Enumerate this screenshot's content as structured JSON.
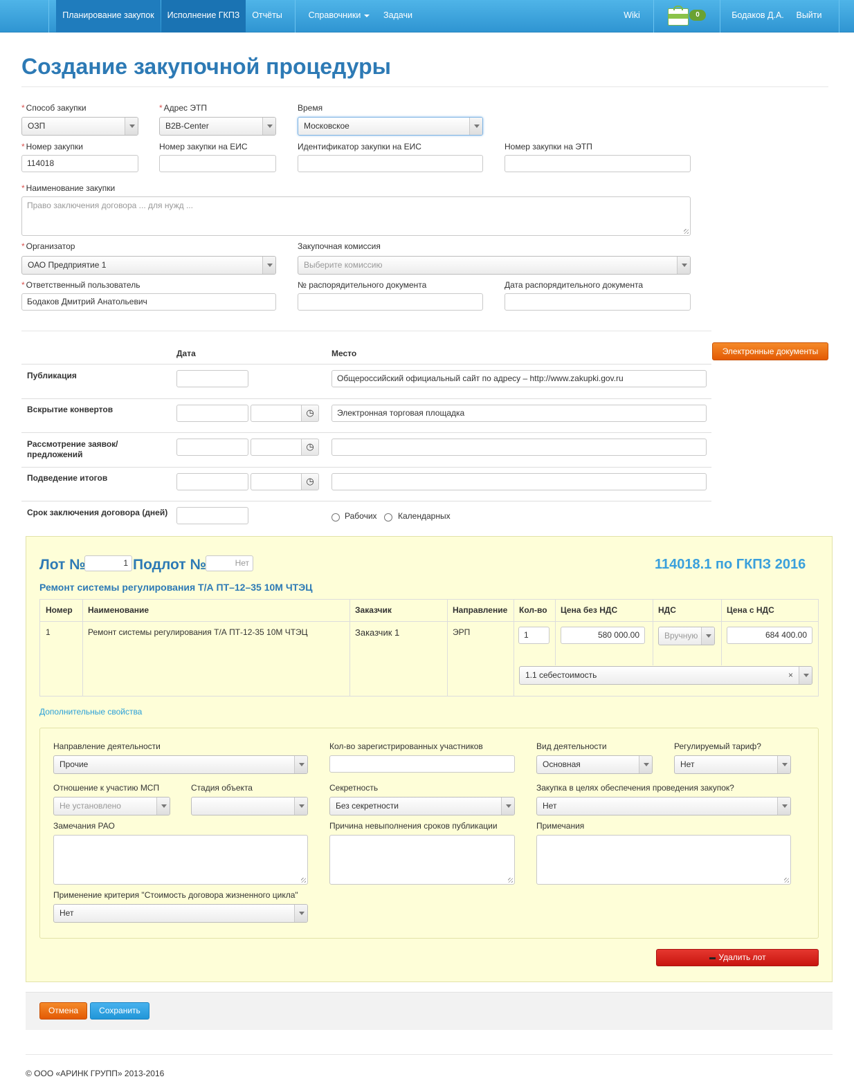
{
  "nav": {
    "items": [
      "Планирование закупок",
      "Исполнение ГКПЗ",
      "Отчёты",
      "Справочники",
      "Задачи"
    ],
    "wiki": "Wiki",
    "cart_count": "0",
    "user": "Бодаков Д.А.",
    "logout": "Выйти"
  },
  "page_title": "Создание закупочной процедуры",
  "form": {
    "method_label": "Способ закупки",
    "method_value": "ОЗП",
    "etp_label": "Адрес ЭТП",
    "etp_value": "B2B-Center",
    "time_label": "Время",
    "time_value": "Московское",
    "number_label": "Номер закупки",
    "number_value": "114018",
    "eis_number_label": "Номер закупки на ЕИС",
    "eis_id_label": "Идентификатор закупки на ЕИС",
    "etp_number_label": "Номер закупки на ЭТП",
    "name_label": "Наименование закупки",
    "name_placeholder": "Право заключения договора ... для нужд ...",
    "organizer_label": "Организатор",
    "organizer_value": "ОАО Предприятие 1",
    "commission_label": "Закупочная комиссия",
    "commission_placeholder": "Выберите комиссию",
    "responsible_label": "Ответственный пользователь",
    "responsible_value": "Бодаков Дмитрий Анатольевич",
    "order_doc_num_label": "№ распорядительного документа",
    "order_doc_date_label": "Дата распорядительного документа"
  },
  "schedule": {
    "col_date": "Дата",
    "col_place": "Место",
    "edocs_button": "Электронные документы",
    "rows": [
      {
        "label": "Публикация",
        "place": "Общероссийский официальный сайт по адресу – http://www.zakupki.gov.ru"
      },
      {
        "label": "Вскрытие конвертов",
        "place": "Электронная торговая площадка"
      },
      {
        "label": "Рассмотрение заявок/предложений",
        "place": ""
      },
      {
        "label": "Подведение итогов",
        "place": ""
      },
      {
        "label": "Срок заключения договора (дней)",
        "place": ""
      }
    ],
    "radio_working": "Рабочих",
    "radio_calendar": "Календарных"
  },
  "lot": {
    "lot_label": "Лот №",
    "lot_number": "1",
    "sublot_label": "Подлот №",
    "sublot_placeholder": "Нет",
    "code": "114018.1 по ГКПЗ 2016",
    "subtitle": "Ремонт системы регулирования Т/А ПТ–12–35 10М ЧТЭЦ",
    "table": {
      "headers": [
        "Номер",
        "Наименование",
        "Заказчик",
        "Направление",
        "Кол-во",
        "Цена без НДС",
        "НДС",
        "Цена с НДС"
      ],
      "row": {
        "number": "1",
        "name": "Ремонт системы регулирования Т/А ПТ-12-35 10М ЧТЭЦ",
        "customer": "Заказчик 1",
        "direction": "ЭРП",
        "qty": "1",
        "price_no_vat": "580 000.00",
        "vat": "Вручную",
        "price_vat": "684 400.00",
        "cost_item": "1.1 себестоимость"
      }
    },
    "extra_link": "Дополнительные свойства",
    "props": {
      "activity_direction_label": "Направление деятельности",
      "activity_direction_value": "Прочие",
      "registered_label": "Кол-во зарегистрированных участников",
      "activity_type_label": "Вид деятельности",
      "activity_type_value": "Основная",
      "tariff_label": "Регулируемый тариф?",
      "tariff_value": "Нет",
      "msp_label": "Отношение к участию МСП",
      "msp_value": "Не установлено",
      "stage_label": "Стадия объекта",
      "secrecy_label": "Секретность",
      "secrecy_value": "Без секретности",
      "support_label": "Закупка в целях обеспечения проведения закупок?",
      "support_value": "Нет",
      "rao_label": "Замечания РАО",
      "reason_label": "Причина невыполнения сроков публикации",
      "notes_label": "Примечания",
      "lifecycle_label": "Применение критерия \"Стоимость договора жизненного цикла\"",
      "lifecycle_value": "Нет"
    },
    "delete_button": "Удалить лот"
  },
  "actions": {
    "cancel": "Отмена",
    "save": "Сохранить"
  },
  "footer": "© ООО «АРИНК ГРУПП» 2013-2016",
  "colors": {
    "nav": "#2f95d2",
    "title": "#2d7ab5",
    "orange": "#e35a04",
    "red": "#c8150f",
    "lot_bg": "#fefed8"
  }
}
